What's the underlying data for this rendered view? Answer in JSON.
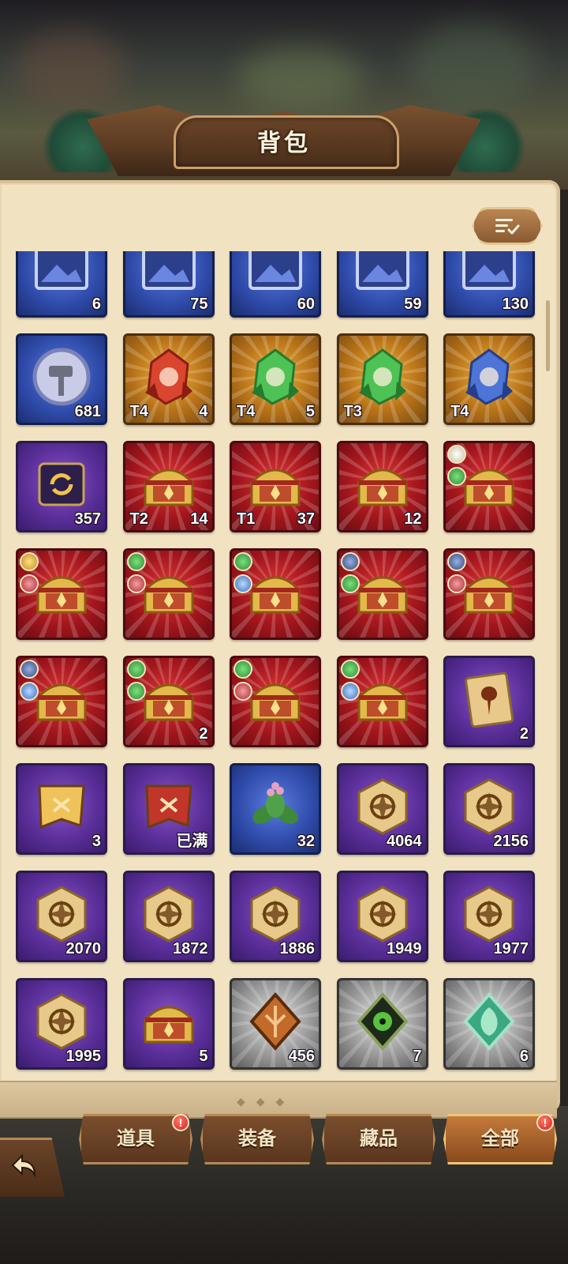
{
  "header": {
    "title": "背包"
  },
  "toolbar": {
    "sort_icon": "sort-list-icon"
  },
  "tabs": [
    {
      "label": "道具",
      "alert": "!"
    },
    {
      "label": "装备",
      "alert": ""
    },
    {
      "label": "藏品",
      "alert": ""
    },
    {
      "label": "全部",
      "alert": "!",
      "active": true
    }
  ],
  "items": [
    {
      "icon": "painting-icon",
      "rarity": "blue",
      "qty": "6",
      "tier": ""
    },
    {
      "icon": "painting-icon",
      "rarity": "blue",
      "qty": "75",
      "tier": ""
    },
    {
      "icon": "painting-icon",
      "rarity": "blue",
      "qty": "60",
      "tier": ""
    },
    {
      "icon": "painting-icon",
      "rarity": "blue",
      "qty": "59",
      "tier": ""
    },
    {
      "icon": "painting-icon",
      "rarity": "blue",
      "qty": "130",
      "tier": ""
    },
    {
      "icon": "hammer-coin-icon",
      "rarity": "blue",
      "qty": "681",
      "tier": ""
    },
    {
      "icon": "strength-crystal-icon",
      "rarity": "gold",
      "qty": "4",
      "tier": "T4"
    },
    {
      "icon": "agility-crystal-icon",
      "rarity": "gold",
      "qty": "5",
      "tier": "T4"
    },
    {
      "icon": "agility-crystal-icon",
      "rarity": "gold",
      "qty": "",
      "tier": "T3"
    },
    {
      "icon": "intelligence-crystal-icon",
      "rarity": "gold",
      "qty": "",
      "tier": "T4"
    },
    {
      "icon": "reset-scroll-icon",
      "rarity": "purple",
      "qty": "357",
      "tier": ""
    },
    {
      "icon": "treasure-chest-icon",
      "rarity": "red",
      "qty": "14",
      "tier": "T2"
    },
    {
      "icon": "treasure-chest-icon",
      "rarity": "red",
      "qty": "37",
      "tier": "T1"
    },
    {
      "icon": "treasure-chest-icon",
      "rarity": "red",
      "qty": "12",
      "tier": ""
    },
    {
      "icon": "treasure-chest-icon",
      "rarity": "red",
      "qty": "",
      "tier": "",
      "badges": [
        "white",
        "green"
      ]
    },
    {
      "icon": "treasure-chest-icon",
      "rarity": "red",
      "qty": "",
      "tier": "",
      "badges": [
        "gold",
        "red"
      ]
    },
    {
      "icon": "treasure-chest-icon",
      "rarity": "red",
      "qty": "",
      "tier": "",
      "badges": [
        "green",
        "red"
      ]
    },
    {
      "icon": "treasure-chest-icon",
      "rarity": "red",
      "qty": "",
      "tier": "",
      "badges": [
        "green",
        "blue"
      ]
    },
    {
      "icon": "treasure-chest-icon",
      "rarity": "red",
      "qty": "",
      "tier": "",
      "badges": [
        "navy",
        "green"
      ]
    },
    {
      "icon": "treasure-chest-icon",
      "rarity": "red",
      "qty": "",
      "tier": "",
      "badges": [
        "navy",
        "red"
      ]
    },
    {
      "icon": "treasure-chest-icon",
      "rarity": "red",
      "qty": "",
      "tier": "",
      "badges": [
        "navy",
        "blue"
      ]
    },
    {
      "icon": "treasure-chest-icon",
      "rarity": "red",
      "qty": "2",
      "tier": "",
      "badges": [
        "green",
        "green"
      ]
    },
    {
      "icon": "treasure-chest-icon",
      "rarity": "red",
      "qty": "",
      "tier": "",
      "badges": [
        "green",
        "red"
      ]
    },
    {
      "icon": "treasure-chest-icon",
      "rarity": "red",
      "qty": "",
      "tier": "",
      "badges": [
        "green",
        "blue"
      ]
    },
    {
      "icon": "tree-card-icon",
      "rarity": "purple",
      "qty": "2",
      "tier": ""
    },
    {
      "icon": "gold-banner-icon",
      "rarity": "purple",
      "qty": "3",
      "tier": ""
    },
    {
      "icon": "red-banner-icon",
      "rarity": "purple",
      "qty": "已满",
      "tier": ""
    },
    {
      "icon": "herb-icon",
      "rarity": "blue",
      "qty": "32",
      "tier": ""
    },
    {
      "icon": "emblem-star-icon",
      "rarity": "purple",
      "qty": "4064",
      "tier": ""
    },
    {
      "icon": "emblem-ring-icon",
      "rarity": "purple",
      "qty": "2156",
      "tier": ""
    },
    {
      "icon": "emblem-lamp-icon",
      "rarity": "purple",
      "qty": "2070",
      "tier": ""
    },
    {
      "icon": "emblem-sword-icon",
      "rarity": "purple",
      "qty": "1872",
      "tier": ""
    },
    {
      "icon": "emblem-plant-icon",
      "rarity": "purple",
      "qty": "1886",
      "tier": ""
    },
    {
      "icon": "emblem-horn-icon",
      "rarity": "purple",
      "qty": "1949",
      "tier": ""
    },
    {
      "icon": "emblem-crown-icon",
      "rarity": "purple",
      "qty": "1977",
      "tier": ""
    },
    {
      "icon": "emblem-flower-icon",
      "rarity": "purple",
      "qty": "1995",
      "tier": ""
    },
    {
      "icon": "chest-small-icon",
      "rarity": "purple",
      "qty": "5",
      "tier": ""
    },
    {
      "icon": "tree-shard-icon",
      "rarity": "silver",
      "qty": "456",
      "tier": ""
    },
    {
      "icon": "dark-eye-shard-icon",
      "rarity": "silver",
      "qty": "7",
      "tier": ""
    },
    {
      "icon": "leaf-shard-icon",
      "rarity": "silver",
      "qty": "6",
      "tier": ""
    },
    {
      "icon": "shield-gold-icon",
      "rarity": "purple",
      "qty": "",
      "tier": ""
    },
    {
      "icon": "shield-blue-icon",
      "rarity": "purple",
      "qty": "",
      "tier": ""
    },
    {
      "icon": "orange-shard-icon",
      "rarity": "red",
      "qty": "",
      "tier": ""
    },
    {
      "icon": "dark-orb-icon",
      "rarity": "red",
      "qty": "",
      "tier": ""
    },
    {
      "icon": "star-orb-icon",
      "rarity": "red",
      "qty": "",
      "tier": ""
    }
  ],
  "colors": {
    "panel": "#f1e2c2",
    "tab_active": "#c47a3a",
    "tab_inactive": "#5a361e",
    "alert": "#d6201a"
  }
}
